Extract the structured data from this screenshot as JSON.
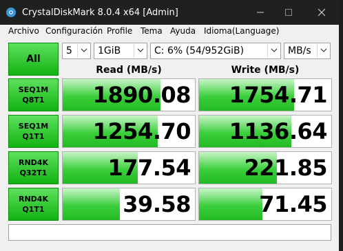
{
  "window": {
    "title": "CrystalDiskMark 8.0.4 x64 [Admin]",
    "icon": "crystaldiskmark-app-icon",
    "controls": [
      "minimize-icon",
      "maximize-icon",
      "close-icon"
    ]
  },
  "menu": {
    "items": [
      "Archivo",
      "Configuración",
      "Profile",
      "Tema",
      "Ayuda",
      "Idioma(Language)"
    ]
  },
  "toolbar": {
    "all_label": "All",
    "count": "5",
    "size": "1GiB",
    "drive": "C: 6% (54/952GiB)",
    "unit": "MB/s"
  },
  "headers": {
    "read": "Read (MB/s)",
    "write": "Write (MB/s)"
  },
  "tests": [
    {
      "line1": "SEQ1M",
      "line2": "Q8T1",
      "read": "1890.08",
      "write": "1754.71"
    },
    {
      "line1": "SEQ1M",
      "line2": "Q1T1",
      "read": "1254.70",
      "write": "1136.64"
    },
    {
      "line1": "RND4K",
      "line2": "Q32T1",
      "read": "177.54",
      "write": "221.85"
    },
    {
      "line1": "RND4K",
      "line2": "Q1T1",
      "read": "39.58",
      "write": "71.45"
    }
  ],
  "bar_levels": {
    "read": [
      0.74,
      0.72,
      0.57,
      0.43
    ],
    "write": [
      0.72,
      0.7,
      0.59,
      0.48
    ]
  },
  "comment": "",
  "colors": {
    "button_green": "#12b312",
    "bar_green": "#3ccf3c",
    "titlebar": "#202020"
  }
}
